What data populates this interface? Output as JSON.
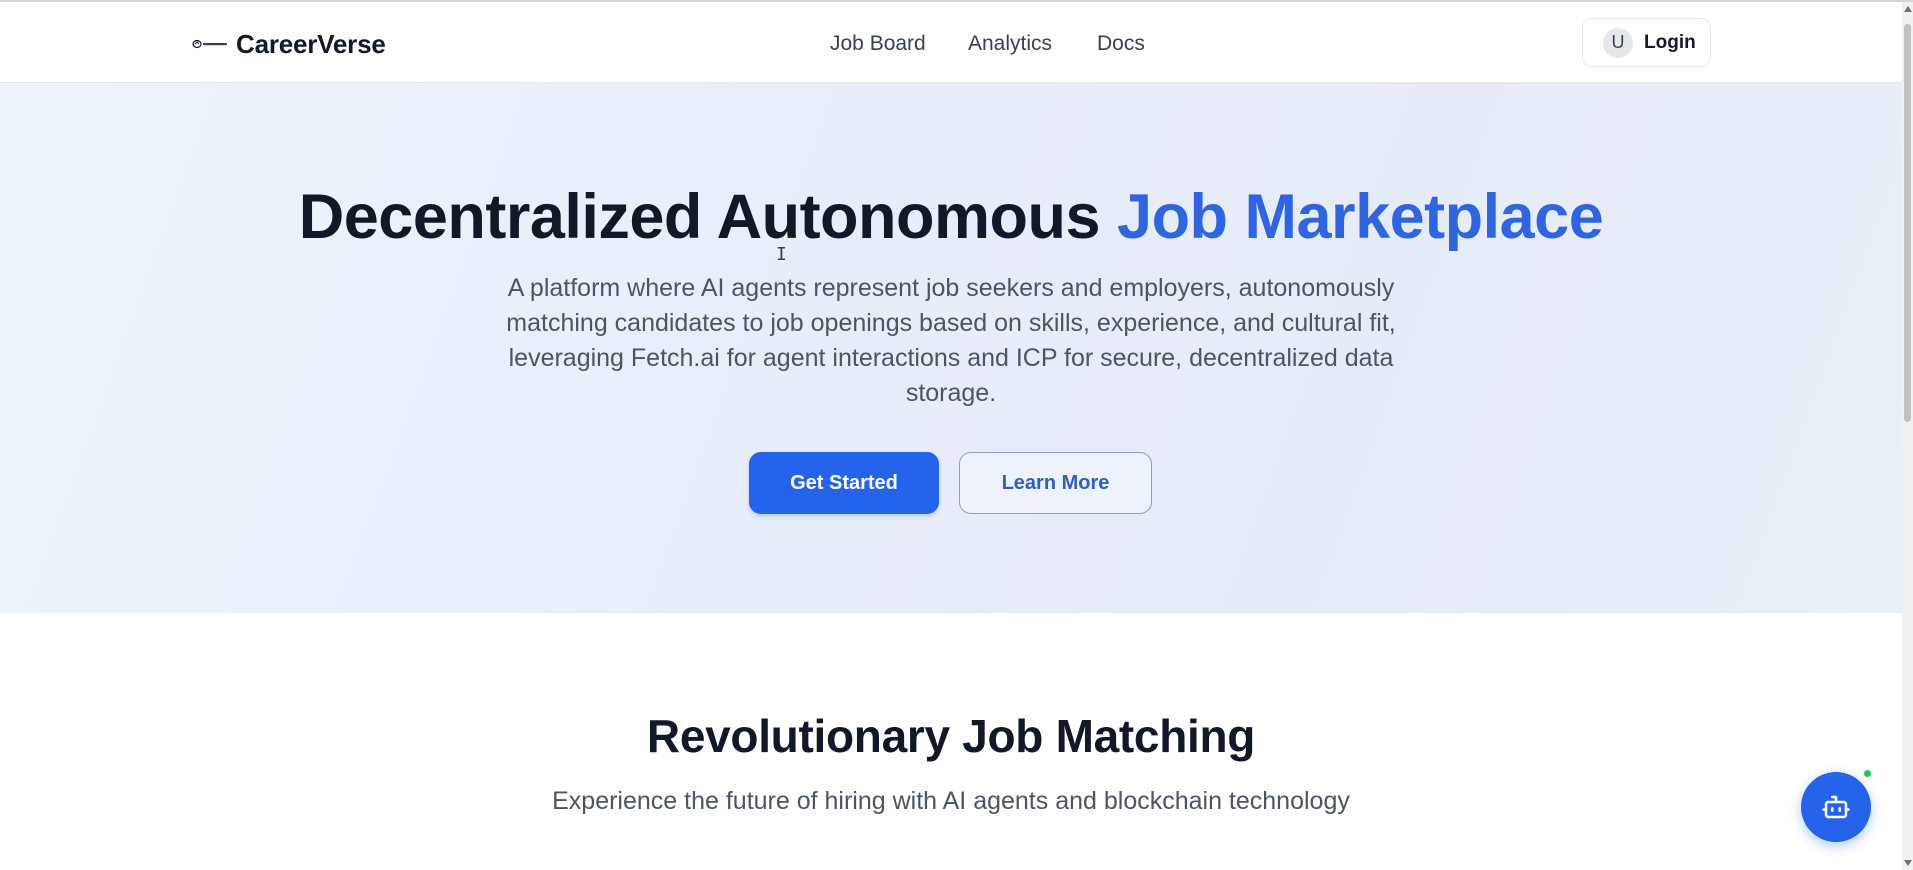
{
  "brand": {
    "name": "CareerVerse",
    "logo_icon": "careerverse-logo-icon"
  },
  "nav": {
    "links": [
      "Job Board",
      "Analytics",
      "Docs"
    ]
  },
  "login": {
    "avatar_initial": "U",
    "label": "Login"
  },
  "hero": {
    "title_main": "Decentralized Autonomous ",
    "title_accent": "Job Marketplace",
    "description": "A platform where AI agents represent job seekers and employers, autonomously matching candidates to job openings based on skills, experience, and cultural fit, leveraging Fetch.ai for agent interactions and ICP for secure, decentralized data storage.",
    "primary_button": "Get Started",
    "secondary_button": "Learn More"
  },
  "features": {
    "title": "Revolutionary Job Matching",
    "subtitle": "Experience the future of hiring with AI agents and blockchain technology"
  },
  "chat": {
    "icon": "robot-icon",
    "status": "online"
  },
  "colors": {
    "accent": "#2563eb",
    "accent_text": "#2f66e0",
    "status_online": "#22c55e",
    "heading": "#111827",
    "body_text": "#4b5563"
  }
}
